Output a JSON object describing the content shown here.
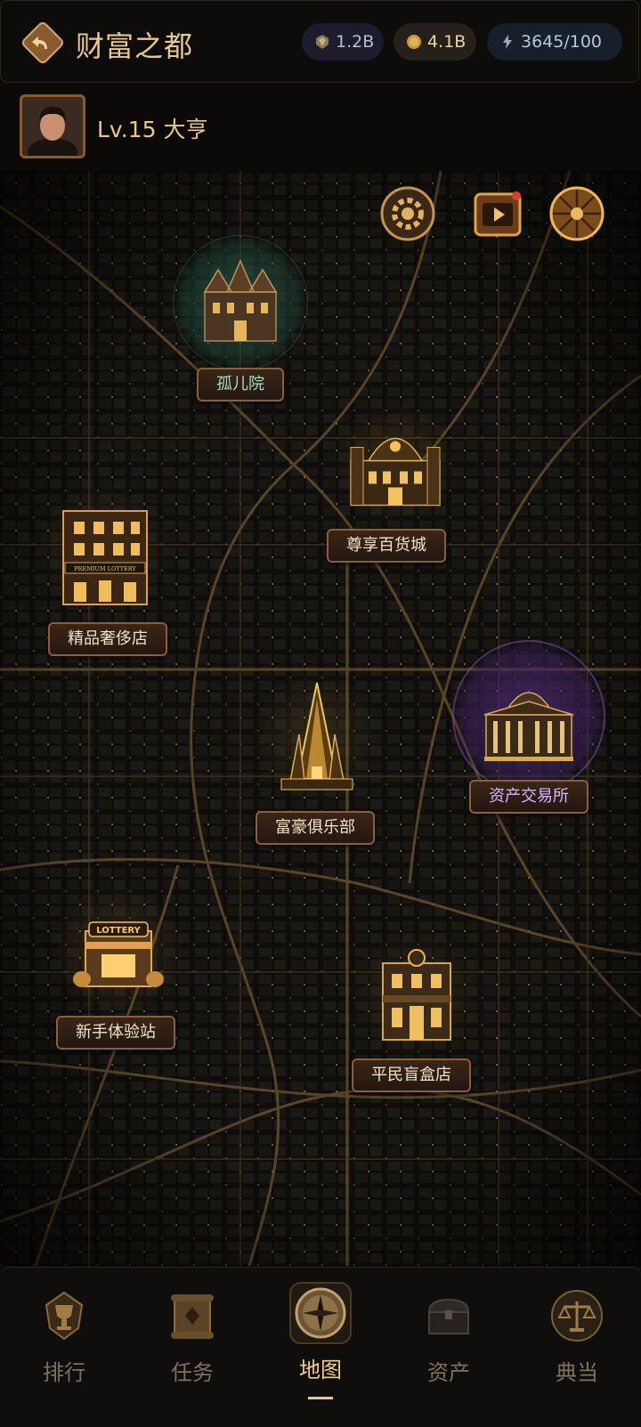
{
  "header": {
    "title": "财富之都",
    "gems": "1.2B",
    "coins": "4.1B",
    "energy": "3645/100"
  },
  "profile": {
    "level": "Lv.15 大亨"
  },
  "map": {
    "locations": [
      {
        "id": "orphanage",
        "label": "孤儿院",
        "style": "green"
      },
      {
        "id": "dept-store",
        "label": "尊享百货城",
        "style": "gold"
      },
      {
        "id": "luxury-shop",
        "label": "精品奢侈店",
        "style": "gold",
        "sign": "PREMIUM LOTTERY"
      },
      {
        "id": "exchange",
        "label": "资产交易所",
        "style": "purple"
      },
      {
        "id": "rich-club",
        "label": "富豪俱乐部",
        "style": "gold"
      },
      {
        "id": "newbie",
        "label": "新手体验站",
        "style": "gold",
        "sign": "LOTTERY"
      },
      {
        "id": "blindbox",
        "label": "平民盲盒店",
        "style": "gold"
      }
    ]
  },
  "nav": {
    "items": [
      {
        "label": "排行",
        "icon": "trophy-icon"
      },
      {
        "label": "任务",
        "icon": "scroll-icon"
      },
      {
        "label": "地图",
        "icon": "compass-icon",
        "active": true
      },
      {
        "label": "资产",
        "icon": "chest-icon"
      },
      {
        "label": "典当",
        "icon": "scales-icon"
      }
    ]
  },
  "colors": {
    "accent": "#e7c98b",
    "label_bg": "#3a2518",
    "purple_glow": "#6b3fa0",
    "green_glow": "#2f6b55"
  }
}
